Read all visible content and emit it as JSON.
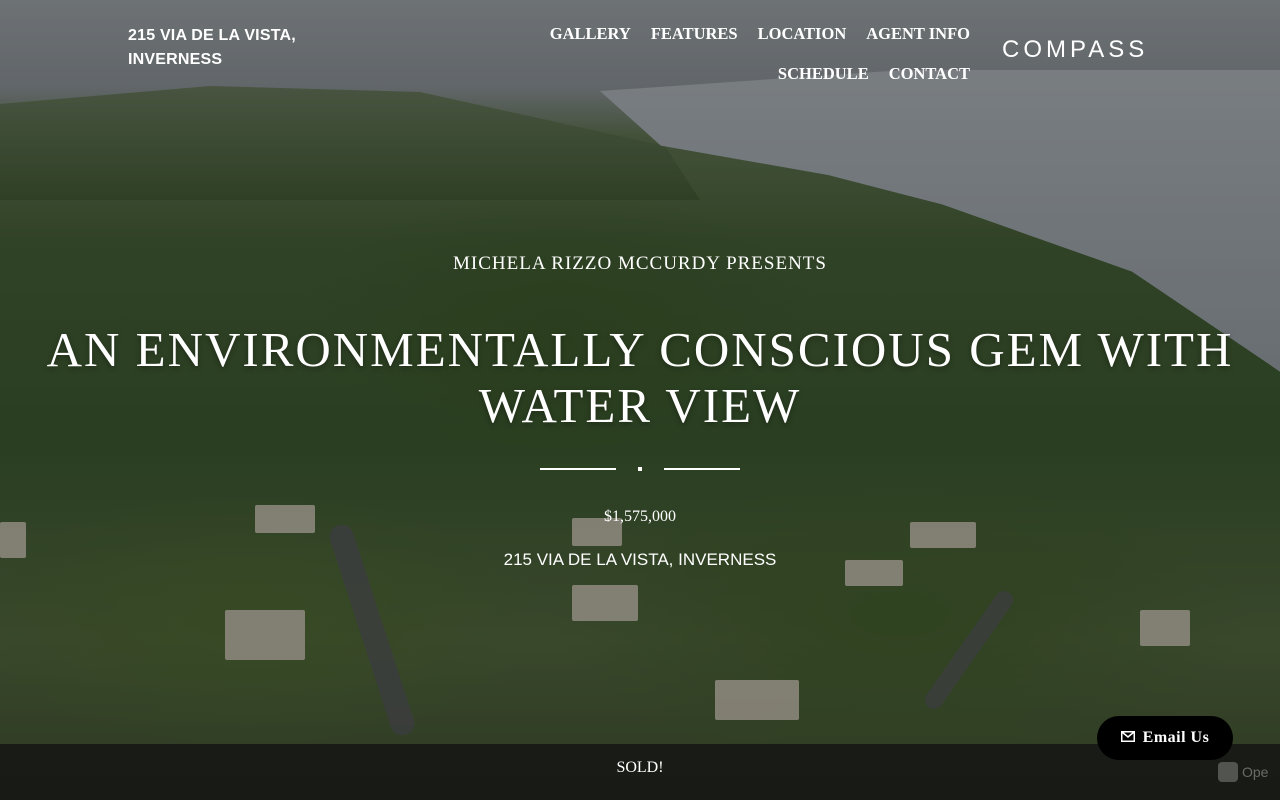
{
  "header": {
    "site_title": "215 VIA DE LA VISTA, INVERNESS",
    "nav": {
      "gallery": "GALLERY",
      "features": "FEATURES",
      "location": "LOCATION",
      "agent_info": "AGENT INFO",
      "schedule": "SCHEDULE",
      "contact": "CONTACT"
    },
    "brand": "COMPASS"
  },
  "hero": {
    "presents": "MICHELA RIZZO MCCURDY PRESENTS",
    "headline": "AN ENVIRONMENTALLY CONSCIOUS GEM WITH WATER VIEW",
    "price": "$1,575,000",
    "address": "215 VIA DE LA VISTA, INVERNESS"
  },
  "status_bar": {
    "text": "SOLD!"
  },
  "email_button": {
    "label": "Email Us",
    "icon": "envelope-icon"
  },
  "badge": {
    "text": "Ope"
  },
  "colors": {
    "bar": "#141414",
    "button": "#000000",
    "text": "#ffffff"
  }
}
